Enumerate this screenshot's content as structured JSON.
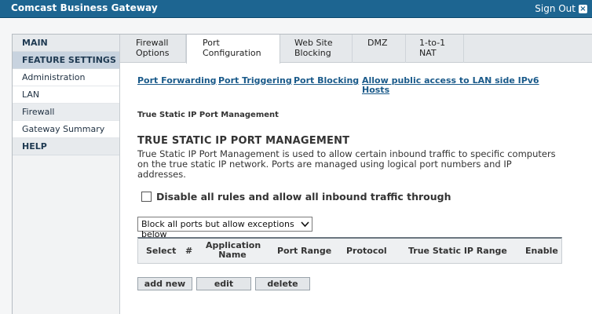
{
  "header": {
    "title": "Comcast Business Gateway",
    "signout_label": "Sign Out",
    "signout_icon": "×"
  },
  "nav": {
    "main": "MAIN",
    "feature_settings": "FEATURE SETTINGS",
    "items": [
      "Administration",
      "LAN",
      "Firewall",
      "Gateway Summary"
    ],
    "help": "HELP"
  },
  "tabs": [
    {
      "line1": "Firewall",
      "line2": "Options"
    },
    {
      "line1": "Port",
      "line2": "Configuration"
    },
    {
      "line1": "Web Site",
      "line2": "Blocking"
    },
    {
      "line1": "DMZ",
      "line2": ""
    },
    {
      "line1": "1-to-1",
      "line2": "NAT"
    }
  ],
  "sublinks": {
    "port_forwarding": "Port Forwarding",
    "port_triggering": "Port Triggering",
    "port_blocking": "Port Blocking",
    "ipv6_line1": "Allow public access to LAN side IPv6",
    "ipv6_line2": "Hosts"
  },
  "breadcrumb": "True Static IP Port Management",
  "section": {
    "heading": "TRUE STATIC IP PORT MANAGEMENT",
    "description": "True Static IP Port Management is used to allow certain inbound traffic to specific computers on the true static IP network. Ports are managed using logical port numbers and IP addresses."
  },
  "checkbox": {
    "label": "Disable all rules and allow all inbound traffic through"
  },
  "policy_select": {
    "value": "Block all ports but allow exceptions below"
  },
  "table": {
    "columns": [
      "Select",
      "#",
      "Application Name",
      "Port Range",
      "Protocol",
      "True Static IP Range",
      "Enable"
    ],
    "app_name_line1": "Application",
    "app_name_line2": "Name"
  },
  "buttons": {
    "add_new": "add new",
    "edit": "edit",
    "delete": "delete"
  },
  "colors": {
    "header_bg": "#1d6591",
    "link": "#1a5a8a",
    "nav_active": "#c8d3df"
  }
}
